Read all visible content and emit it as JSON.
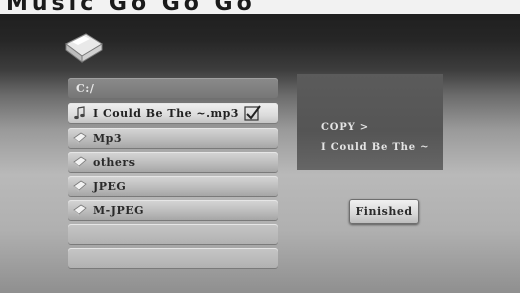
{
  "header": {
    "partial_title": "Music Go Go Go"
  },
  "browser": {
    "path": "C:/",
    "items": [
      {
        "label": "I Could Be The ~.mp3",
        "icon": "music-note-icon",
        "checked": true
      },
      {
        "label": "Mp3",
        "icon": "folder-icon"
      },
      {
        "label": "others",
        "icon": "folder-icon"
      },
      {
        "label": "JPEG",
        "icon": "folder-icon"
      },
      {
        "label": "M-JPEG",
        "icon": "folder-icon"
      }
    ]
  },
  "status": {
    "action": "COPY >",
    "file": "I Could Be The ~"
  },
  "actions": {
    "finished_label": "Finished"
  },
  "colors": {
    "panel": "#555555",
    "row": "#bdbdbd",
    "selected_row": "#e6e6e6"
  }
}
